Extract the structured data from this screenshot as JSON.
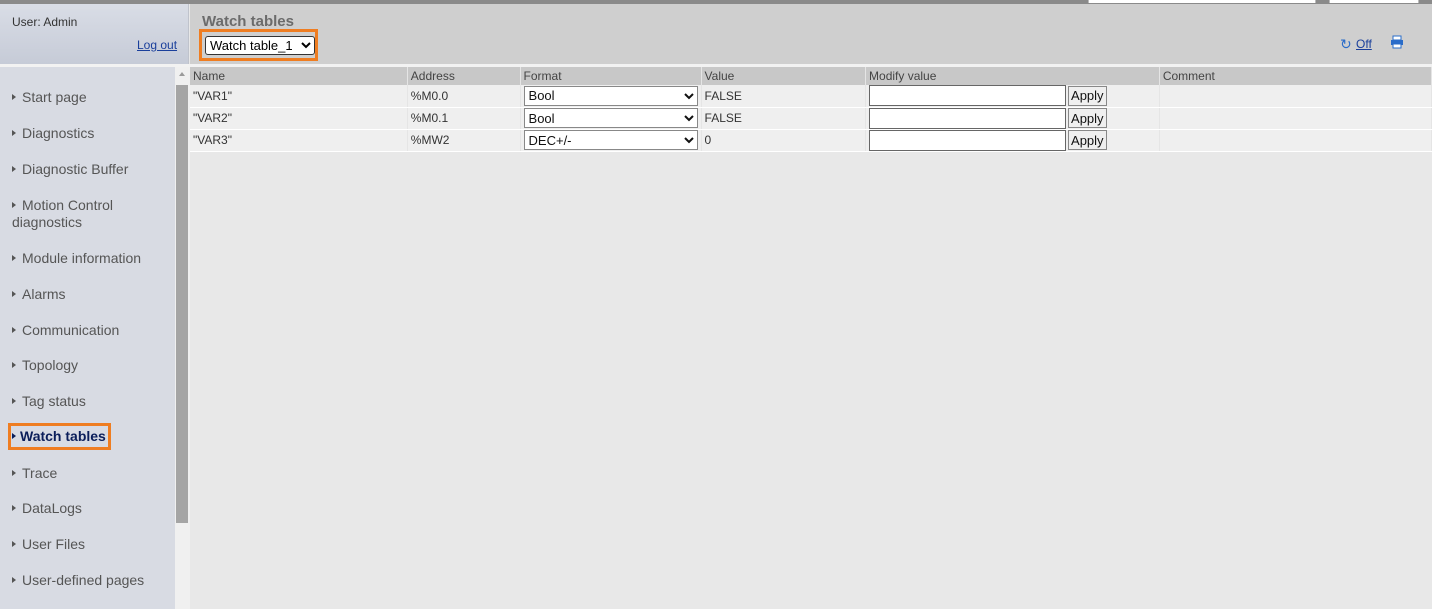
{
  "user": {
    "label": "User: Admin",
    "logout": "Log out"
  },
  "header": {
    "title": "Watch tables",
    "table_select": {
      "selected": "Watch table_1"
    },
    "refresh_link": "Off"
  },
  "sidebar": {
    "items": [
      {
        "label": "Start page"
      },
      {
        "label": "Diagnostics"
      },
      {
        "label": "Diagnostic Buffer"
      },
      {
        "label": "Motion Control diagnostics"
      },
      {
        "label": "Module information"
      },
      {
        "label": "Alarms"
      },
      {
        "label": "Communication"
      },
      {
        "label": "Topology"
      },
      {
        "label": "Tag status"
      },
      {
        "label": "Watch tables",
        "active": true
      },
      {
        "label": "Trace"
      },
      {
        "label": "DataLogs"
      },
      {
        "label": "User Files"
      },
      {
        "label": "User-defined pages"
      }
    ]
  },
  "table": {
    "columns": [
      "Name",
      "Address",
      "Format",
      "Value",
      "Modify value",
      "Comment"
    ],
    "rows": [
      {
        "name": "\"VAR1\"",
        "address": "%M0.0",
        "format": "Bool",
        "value": "FALSE",
        "modify": "",
        "apply": "Apply",
        "comment": ""
      },
      {
        "name": "\"VAR2\"",
        "address": "%M0.1",
        "format": "Bool",
        "value": "FALSE",
        "modify": "",
        "apply": "Apply",
        "comment": ""
      },
      {
        "name": "\"VAR3\"",
        "address": "%MW2",
        "format": "DEC+/-",
        "value": "0",
        "modify": "",
        "apply": "Apply",
        "comment": ""
      }
    ]
  },
  "colors": {
    "highlight": "#ef7d21",
    "link": "#1a3f9b",
    "active_nav": "#0b1e5a"
  }
}
